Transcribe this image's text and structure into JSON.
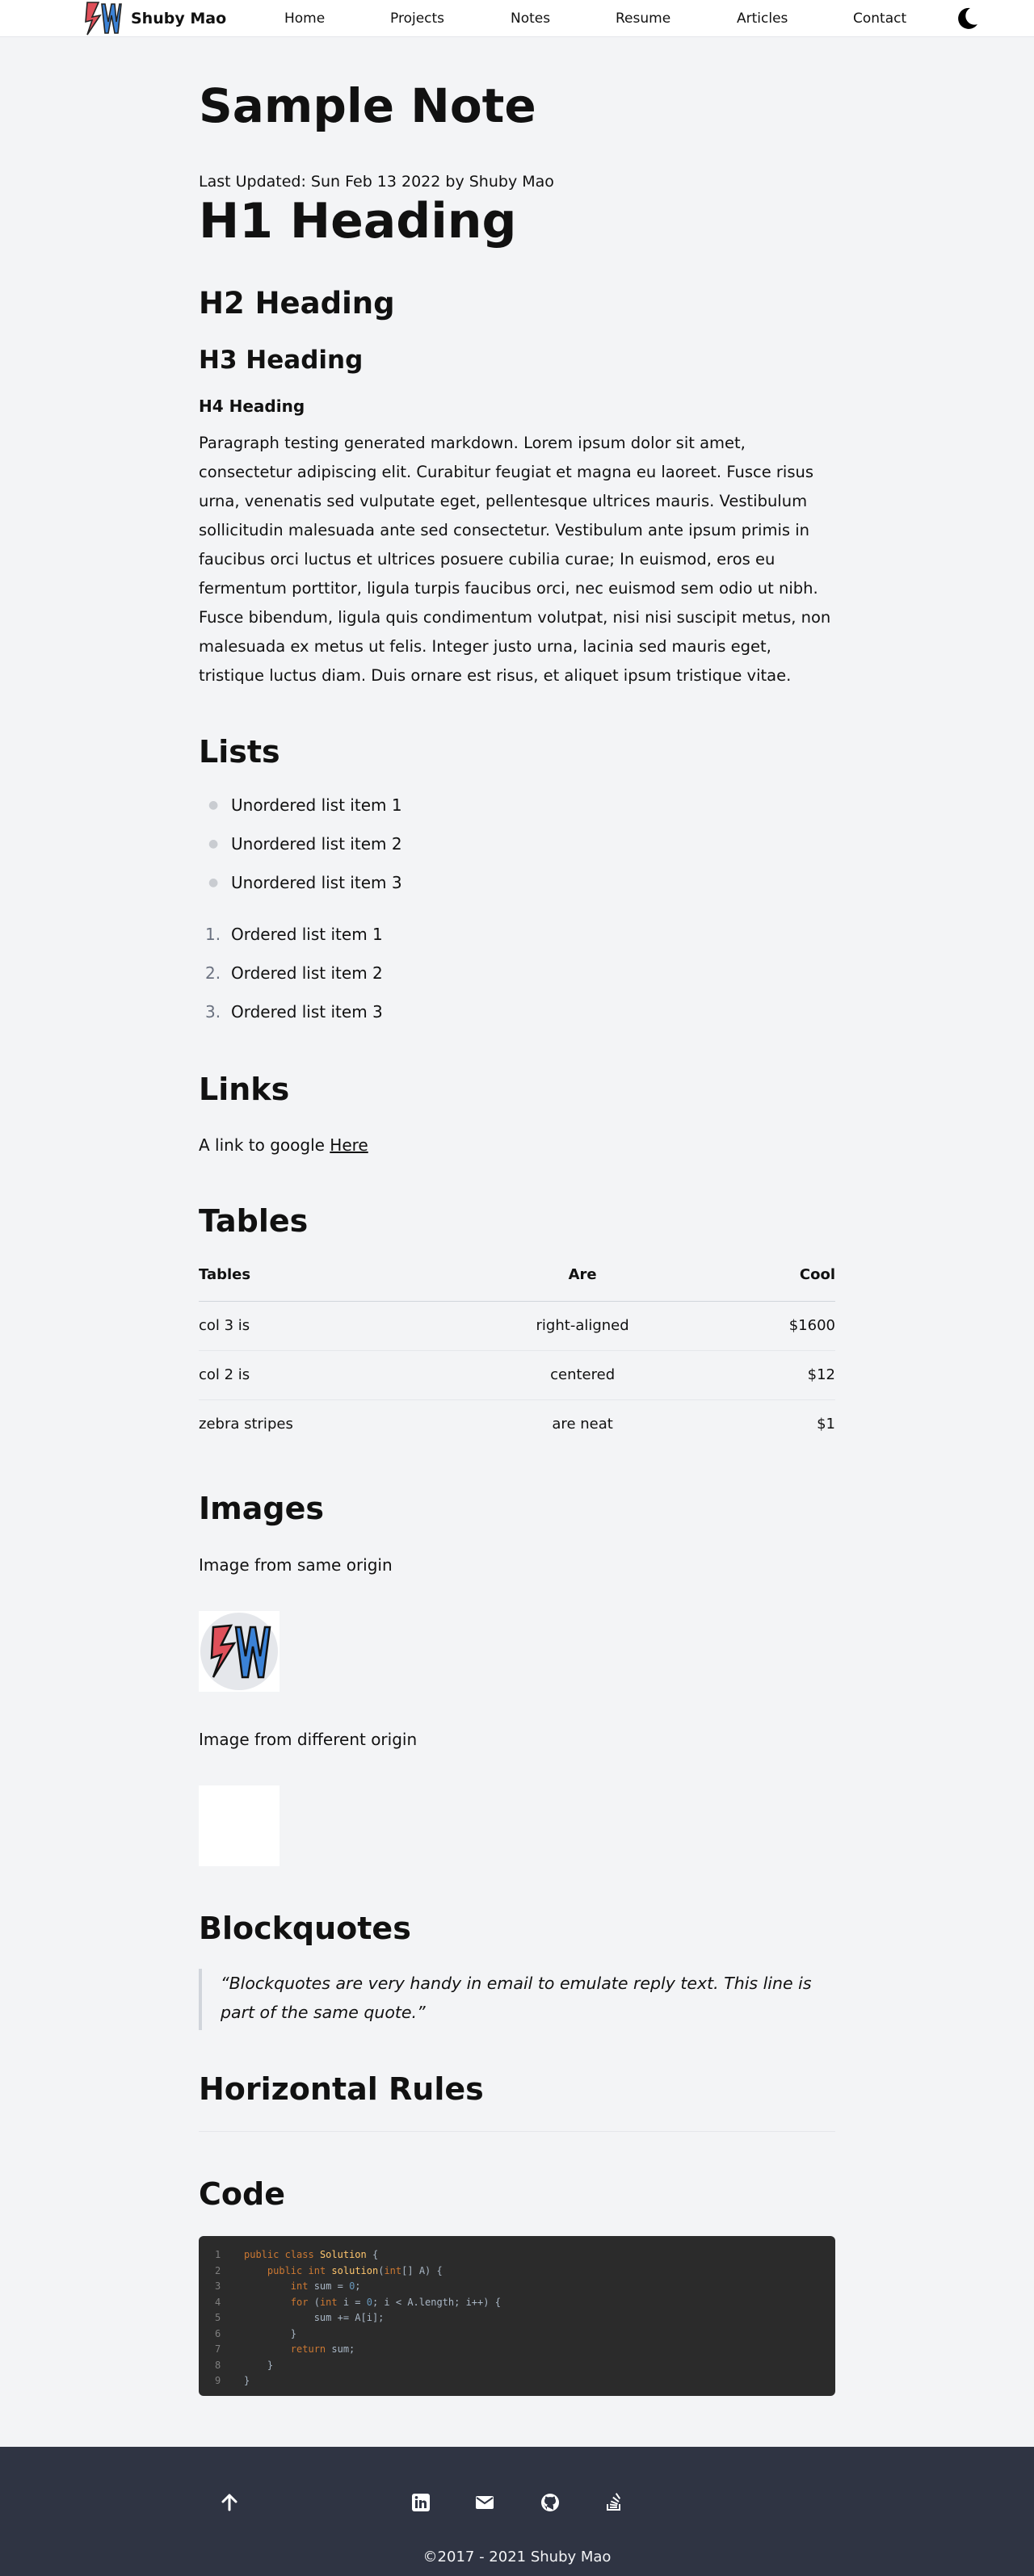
{
  "brand": {
    "name": "Shuby Mao"
  },
  "nav": [
    "Home",
    "Projects",
    "Notes",
    "Resume",
    "Articles",
    "Contact"
  ],
  "page": {
    "title": "Sample Note",
    "meta": "Last Updated: Sun Feb 13 2022 by Shuby Mao"
  },
  "headings": {
    "h1": "H1 Heading",
    "h2": "H2 Heading",
    "h3": "H3 Heading",
    "h4": "H4 Heading"
  },
  "paragraph": "Paragraph testing generated markdown. Lorem ipsum dolor sit amet, consectetur adipiscing elit. Curabitur feugiat et magna eu laoreet. Fusce risus urna, venenatis sed vulputate eget, pellentesque ultrices mauris. Vestibulum sollicitudin malesuada ante sed consectetur. Vestibulum ante ipsum primis in faucibus orci luctus et ultrices posuere cubilia curae; In euismod, eros eu fermentum porttitor, ligula turpis faucibus orci, nec euismod sem odio ut nibh. Fusce bibendum, ligula quis condimentum volutpat, nisi nisi suscipit metus, non malesuada ex metus ut felis. Integer justo urna, lacinia sed mauris eget, tristique luctus diam. Duis ornare est risus, et aliquet ipsum tristique vitae.",
  "lists": {
    "heading": "Lists",
    "unordered": [
      "Unordered list item 1",
      "Unordered list item 2",
      "Unordered list item 3"
    ],
    "ordered_markers": [
      "1.",
      "2.",
      "3."
    ],
    "ordered": [
      "Ordered list item 1",
      "Ordered list item 2",
      "Ordered list item 3"
    ]
  },
  "links": {
    "heading": "Links",
    "text": "A link to google",
    "link_label": "Here"
  },
  "tables": {
    "heading": "Tables",
    "headers": [
      "Tables",
      "Are",
      "Cool"
    ],
    "rows": [
      [
        "col 3 is",
        "right-aligned",
        "$1600"
      ],
      [
        "col 2 is",
        "centered",
        "$12"
      ],
      [
        "zebra stripes",
        "are neat",
        "$1"
      ]
    ]
  },
  "images": {
    "heading": "Images",
    "same_origin_label": "Image from same origin",
    "different_origin_label": "Image from different origin"
  },
  "blockquotes": {
    "heading": "Blockquotes",
    "quote": "“Blockquotes are very handy in email to emulate reply text. This line is part of the same quote.”"
  },
  "rules": {
    "heading": "Horizontal Rules"
  },
  "code": {
    "heading": "Code",
    "line_numbers": [
      "1",
      "2",
      "3",
      "4",
      "5",
      "6",
      "7",
      "8",
      "9"
    ],
    "lines": [
      "public class Solution {",
      "    public int solution(int[] A) {",
      "        int sum = 0;",
      "        for (int i = 0; i < A.length; i++) {",
      "            sum += A[i];",
      "        }",
      "        return sum;",
      "    }",
      "}"
    ]
  },
  "footer": {
    "icons": [
      "arrow-up-icon",
      "linkedin-icon",
      "email-icon",
      "github-icon",
      "stackoverflow-icon"
    ],
    "copyright": "©2017 - 2021 Shuby Mao"
  },
  "colors": {
    "background": "#f3f4f6",
    "footer": "#2f3443",
    "code_bg": "#2b2b2b",
    "logo_red": "#e0505a",
    "logo_blue": "#3b82d6"
  }
}
